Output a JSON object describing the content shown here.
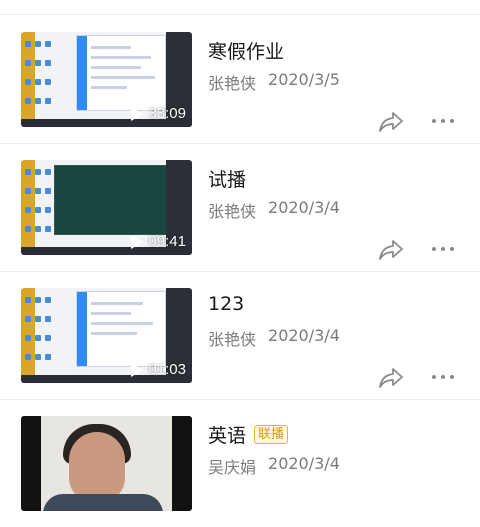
{
  "videos": [
    {
      "title": "寒假作业",
      "author": "张艳侠",
      "date": "2020/3/5",
      "duration": "33:09",
      "badge": ""
    },
    {
      "title": "试播",
      "author": "张艳侠",
      "date": "2020/3/4",
      "duration": "09:41",
      "badge": ""
    },
    {
      "title": "123",
      "author": "张艳侠",
      "date": "2020/3/4",
      "duration": "01:03",
      "badge": ""
    },
    {
      "title": "英语",
      "author": "吴庆娟",
      "date": "2020/3/4",
      "duration": "",
      "badge": "联播"
    }
  ],
  "icons": {
    "share": "share-icon",
    "more": "more-options-icon",
    "play": "play-icon"
  },
  "colors": {
    "badge": "#d89b12",
    "meta_text": "#7b7b7b",
    "divider": "#ececec"
  }
}
